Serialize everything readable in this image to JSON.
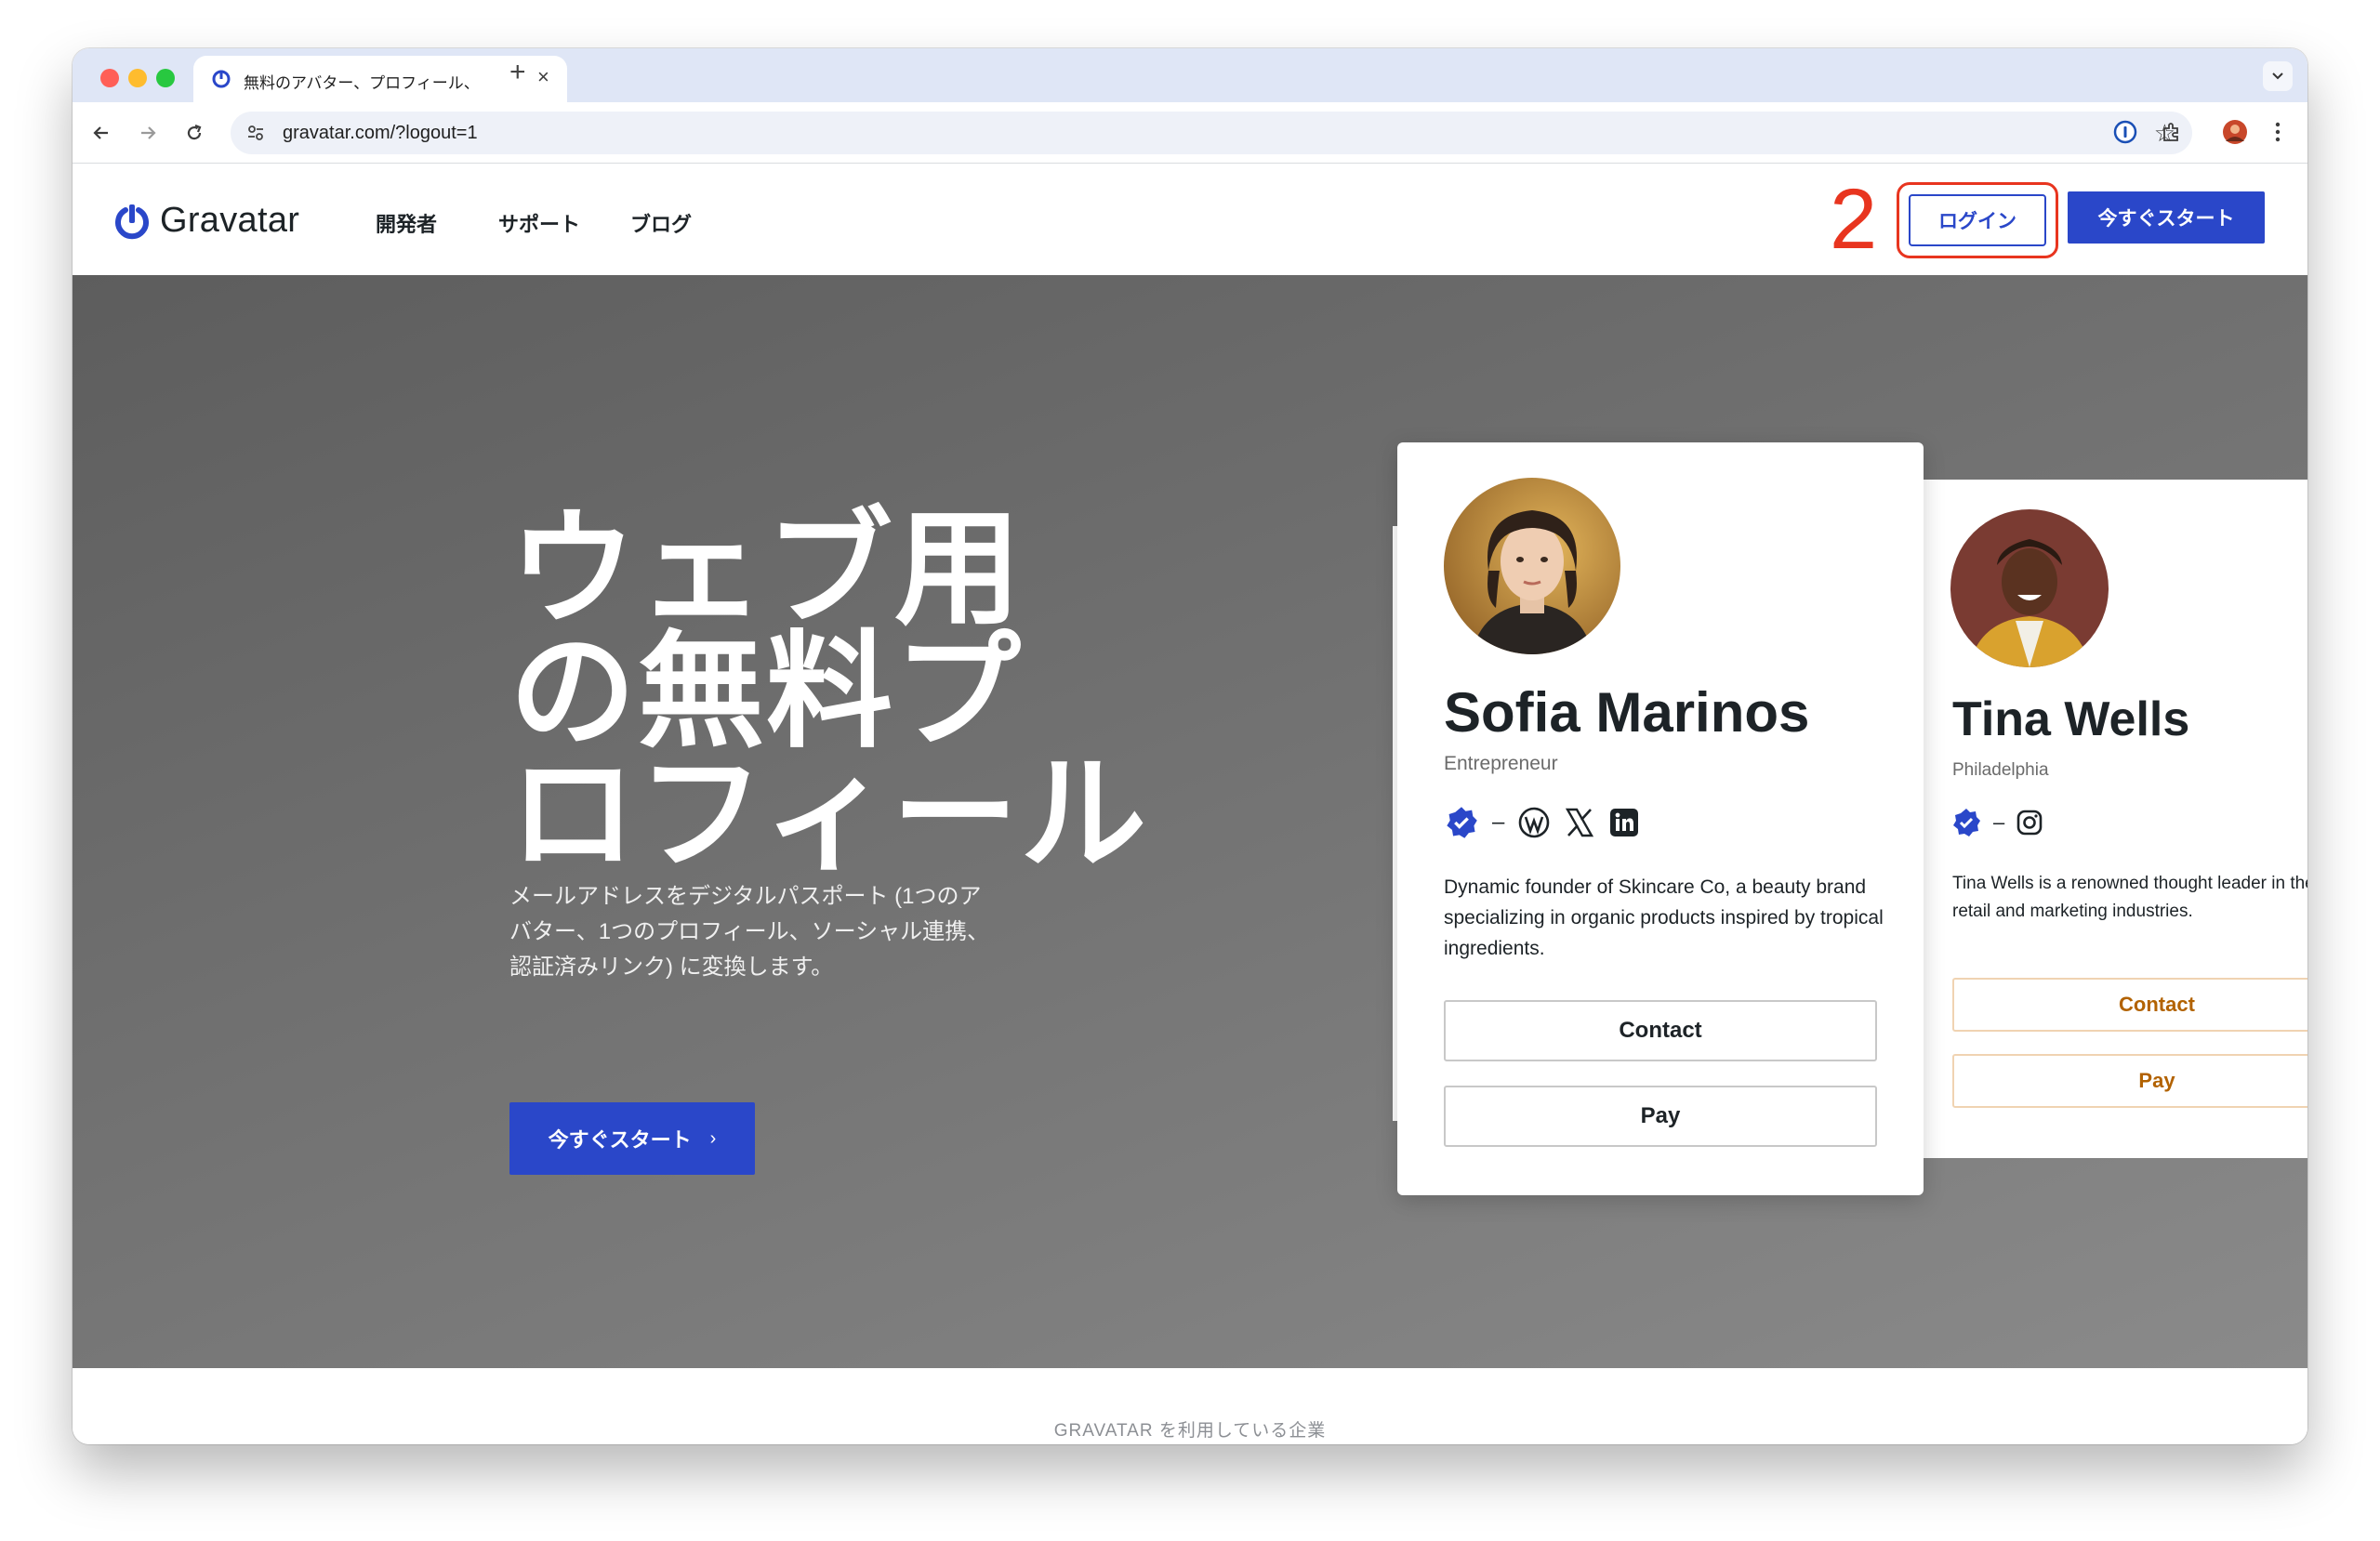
{
  "browser": {
    "tab_title": "無料のアバター、プロフィール、",
    "url": "gravatar.com/?logout=1"
  },
  "site": {
    "logo_text": "Gravatar",
    "nav": [
      "開発者",
      "サポート",
      "ブログ"
    ],
    "login_label": "ログイン",
    "start_label": "今すぐスタート",
    "annotation_number": "2"
  },
  "hero": {
    "title_lines": [
      "ウェブ用",
      "の無料プ",
      "ロフィール"
    ],
    "subtitle": "メールアドレスをデジタルパスポート (1つのアバター、1つのプロフィール、ソーシャル連携、認証済みリンク) に変換します。",
    "cta_label": "今すぐスタート",
    "cta_arrow": "›"
  },
  "profiles": [
    {
      "name": "Sofia Marinos",
      "meta": "Entrepreneur",
      "bio": "Dynamic founder of Skincare Co, a beauty brand specializing in organic products inspired by tropical ingredients.",
      "contact_label": "Contact",
      "pay_label": "Pay",
      "socials": [
        "verified-icon",
        "wordpress-icon",
        "x-icon",
        "linkedin-icon"
      ],
      "separator": "–"
    },
    {
      "name": "Tina Wells",
      "meta": "Philadelphia",
      "bio": "Tina Wells is a renowned thought leader in the retail and marketing industries.",
      "contact_label": "Contact",
      "pay_label": "Pay",
      "socials": [
        "verified-icon",
        "instagram-icon"
      ],
      "separator": "–"
    }
  ],
  "companies_label": "GRAVATAR を利用している企業",
  "colors": {
    "brand_blue": "#2a47c9",
    "annotation_red": "#e8351f",
    "accent_orange": "#b26200"
  }
}
